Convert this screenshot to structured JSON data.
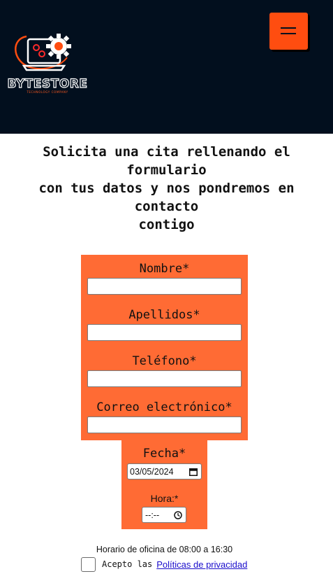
{
  "header": {
    "logo_text": "BYTESTORE",
    "logo_subtext": "TECHNOLOGY COMPANY",
    "menu_icon": "hamburger-menu-icon",
    "background": "#020f1e",
    "accent": "#ff4d10"
  },
  "intro": {
    "line1": "Solicita una cita rellenando el formulario",
    "line2": "con tus datos y nos pondremos en contacto",
    "line3": "contigo"
  },
  "form": {
    "panel_color": "#ff6b34",
    "nombre_label": "Nombre*",
    "nombre_value": "",
    "apellidos_label": "Apellidos*",
    "apellidos_value": "",
    "telefono_label": "Teléfono*",
    "telefono_value": "",
    "correo_label": "Correo electrónico*",
    "correo_value": "",
    "fecha_label": "Fecha*",
    "fecha_value": "03/05/2024",
    "hora_label": "Hora:*",
    "hora_value": "--:--",
    "horario_text": "Horario de oficina de 08:00 a 16:30",
    "acepto_text": "Acepto las",
    "privacy_link": "Políticas de privacidad",
    "privacy_checked": false
  }
}
